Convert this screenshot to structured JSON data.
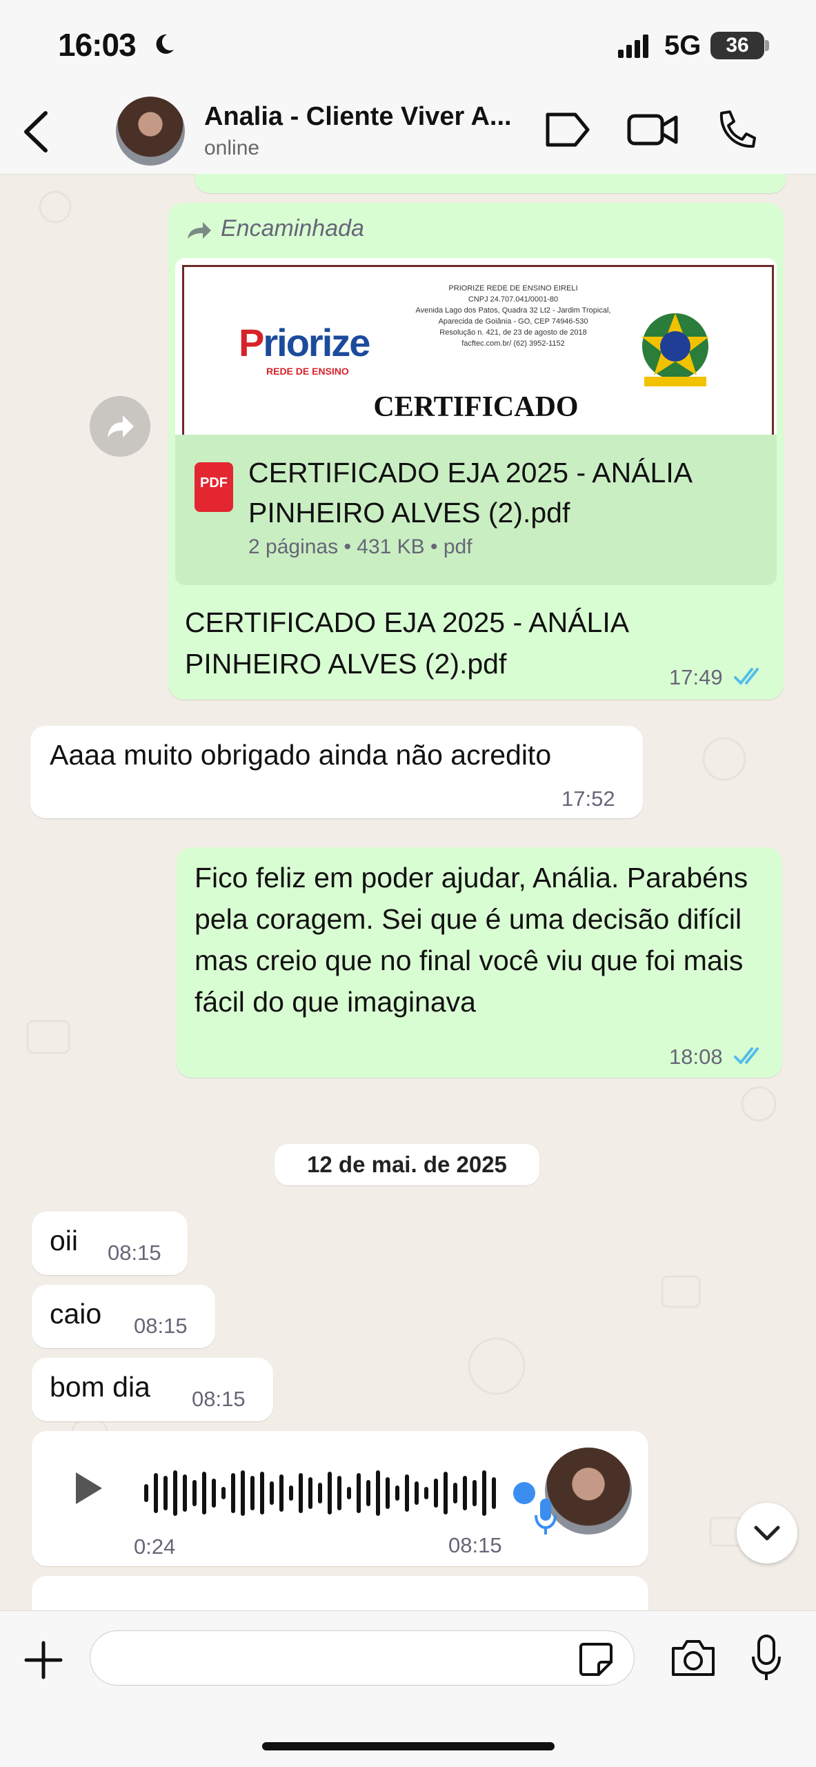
{
  "status_bar": {
    "time": "16:03",
    "network": "5G",
    "battery": "36"
  },
  "header": {
    "contact_name": "Analia - Cliente Viver A...",
    "status": "online"
  },
  "messages": {
    "forwarded_doc": {
      "forwarded_label": "Encaminhada",
      "preview": {
        "company": "PRIORIZE REDE DE ENSINO EIRELI",
        "cnpj": "CNPJ 24.707.041/0001-80",
        "address1": "Avenida Lago dos Patos, Quadra 32 Lt2 - Jardim Tropical,",
        "address2": "Aparecida de Goiânia - GO, CEP 74946-530",
        "resolution": "Resolução n. 421, de 23 de agosto de 2018",
        "contact": "facftec.com.br/ (62) 3952-1152",
        "logo_p": "P",
        "logo_rest": "riorize",
        "logo_sub": "REDE DE ENSINO",
        "title": "CERTIFICADO"
      },
      "file_icon_label": "PDF",
      "file_name": "CERTIFICADO EJA  2025 - ANÁLIA PINHEIRO ALVES (2).pdf",
      "file_meta": "2 páginas • 431 KB • pdf",
      "caption": "CERTIFICADO EJA  2025 - ANÁLIA PINHEIRO ALVES (2).pdf",
      "time": "17:49"
    },
    "m_thanks": {
      "text": "Aaaa muito obrigado ainda não acredito",
      "time": "17:52"
    },
    "m_reply": {
      "text": "Fico feliz em poder ajudar, Anália. Parabéns pela coragem. Sei que é uma decisão difícil mas creio que no final você viu que foi mais fácil do que imaginava",
      "time": "18:08"
    },
    "date_separator": "12 de mai. de 2025",
    "m_oii": {
      "text": "oii",
      "time": "08:15"
    },
    "m_caio": {
      "text": "caio",
      "time": "08:15"
    },
    "m_bomdia": {
      "text": "bom dia",
      "time": "08:15"
    },
    "voice": {
      "duration": "0:24",
      "time": "08:15"
    }
  },
  "composer": {
    "placeholder": ""
  },
  "colors": {
    "outgoing": "#d9fdd3",
    "incoming": "#ffffff",
    "read_ticks": "#53bdeb",
    "background": "#f2ede6"
  }
}
